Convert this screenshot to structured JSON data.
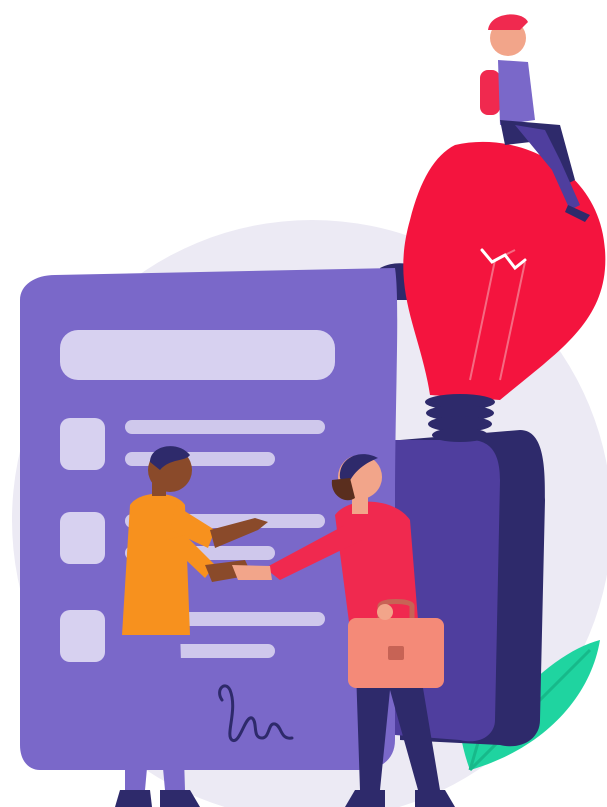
{
  "illustration": {
    "subject": "agreement-handshake",
    "icons": [
      "document-icon",
      "lightbulb-icon",
      "leaf-icon",
      "briefcase-icon",
      "signature-icon"
    ],
    "colors": {
      "background": "#ffffff",
      "backdrop_circle": "#ECEAF4",
      "document": "#7A68C9",
      "document_dark": "#4F3E9E",
      "document_shadow": "#2E2A6B",
      "document_lines": "#CFC8EC",
      "document_boxes": "#D7D1F0",
      "bulb": "#F4143E",
      "bulb_base": "#2E2A6B",
      "leaf": "#1FD4A0",
      "shirt_left": "#F7911E",
      "pants_left": "#7A68C9",
      "shirt_right": "#F0294F",
      "pants_right": "#2E2A6B",
      "briefcase": "#F48A78",
      "skin_left": "#8A4A2A",
      "skin_right": "#F2A58A",
      "hair": "#2E2A6B"
    }
  }
}
